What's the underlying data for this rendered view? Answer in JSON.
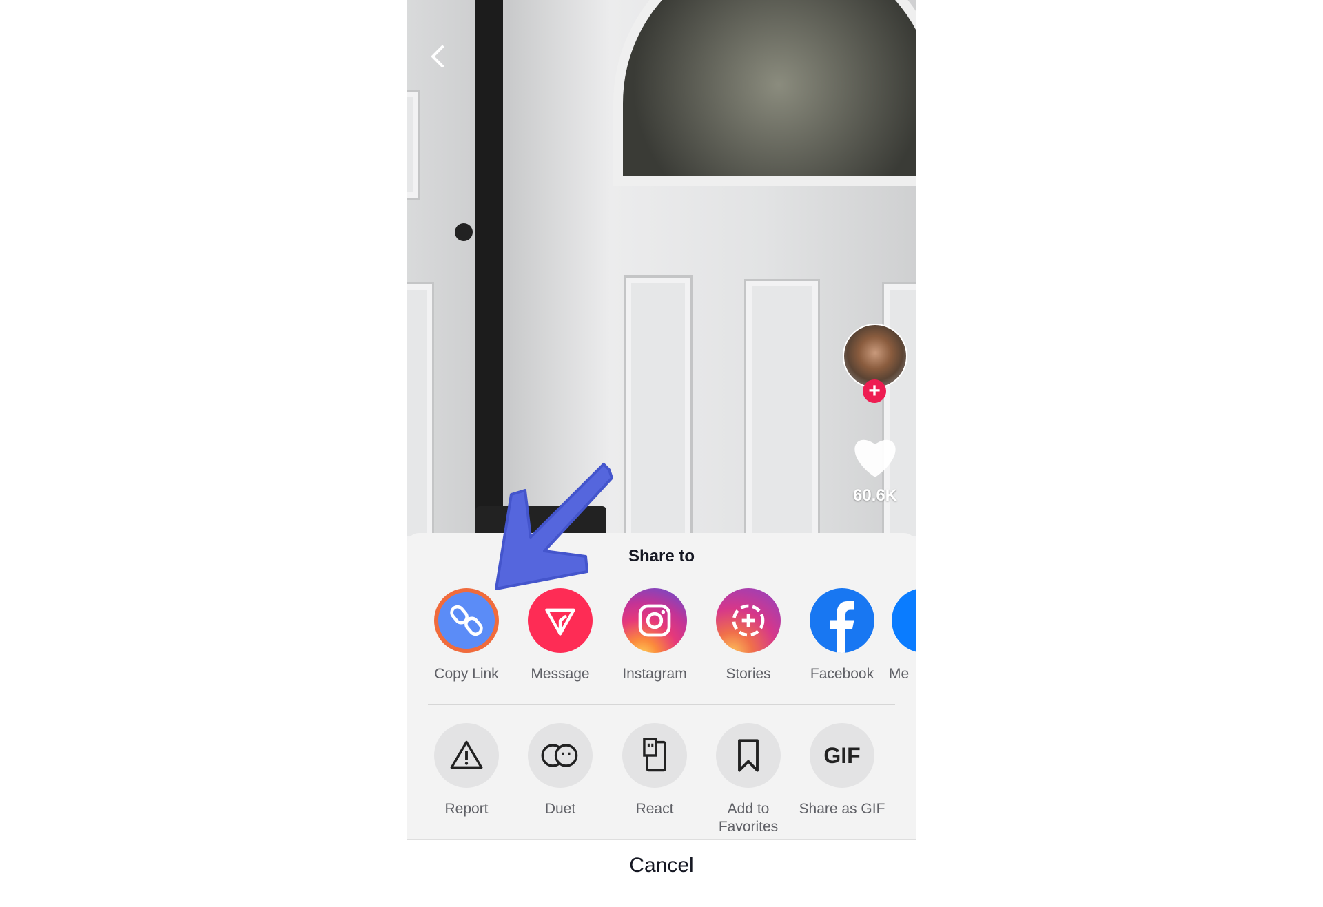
{
  "video": {
    "like_count": "60.6K"
  },
  "sheet": {
    "title": "Share to",
    "share_targets": [
      {
        "label": "Copy Link",
        "icon": "link-icon",
        "color": "#5b8cf7"
      },
      {
        "label": "Message",
        "icon": "send-icon",
        "color": "#fe2c55"
      },
      {
        "label": "Instagram",
        "icon": "instagram-icon"
      },
      {
        "label": "Stories",
        "icon": "stories-icon"
      },
      {
        "label": "Facebook",
        "icon": "facebook-icon",
        "color": "#1877f2"
      },
      {
        "label": "Me",
        "icon": "messenger-icon"
      }
    ],
    "actions": [
      {
        "label": "Report",
        "icon": "warning-icon"
      },
      {
        "label": "Duet",
        "icon": "duet-icon"
      },
      {
        "label": "React",
        "icon": "react-icon"
      },
      {
        "label": "Add to Favorites",
        "icon": "bookmark-icon"
      },
      {
        "label": "Share as GIF",
        "icon": "gif-icon",
        "glyph": "GIF"
      }
    ],
    "cancel": "Cancel"
  },
  "annotation": {
    "arrow_color": "#5566dd"
  }
}
